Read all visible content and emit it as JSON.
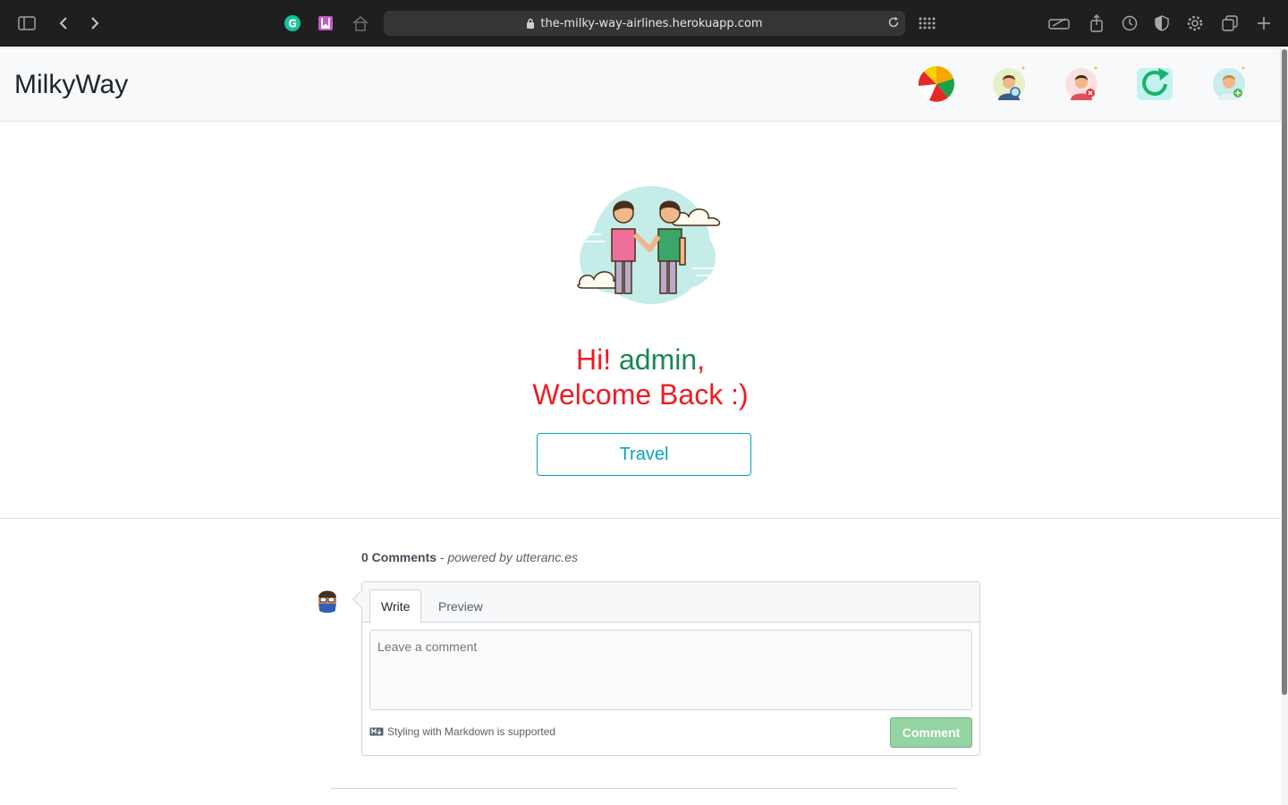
{
  "browser": {
    "url": "the-milky-way-airlines.herokuapp.com"
  },
  "navbar": {
    "brand": "MilkyWay",
    "icons": [
      {
        "name": "chart-pie-icon"
      },
      {
        "name": "search-user-icon"
      },
      {
        "name": "remove-user-icon"
      },
      {
        "name": "refresh-icon"
      },
      {
        "name": "add-user-icon"
      }
    ]
  },
  "hero": {
    "greeting_prefix": "Hi! ",
    "username": "admin",
    "greeting_suffix": ",",
    "welcome": "Welcome Back :)",
    "travel_button": "Travel"
  },
  "comments": {
    "count_label": "0 Comments",
    "separator": " - ",
    "powered_by": "powered by utteranc.es",
    "tab_write": "Write",
    "tab_preview": "Preview",
    "placeholder": "Leave a comment",
    "markdown_note": "Styling with Markdown is supported",
    "submit": "Comment"
  },
  "colors": {
    "greeting": "#ed1c24",
    "username": "#198754",
    "travel": "#0aa2c0",
    "comment_button": "#94d3a2"
  }
}
